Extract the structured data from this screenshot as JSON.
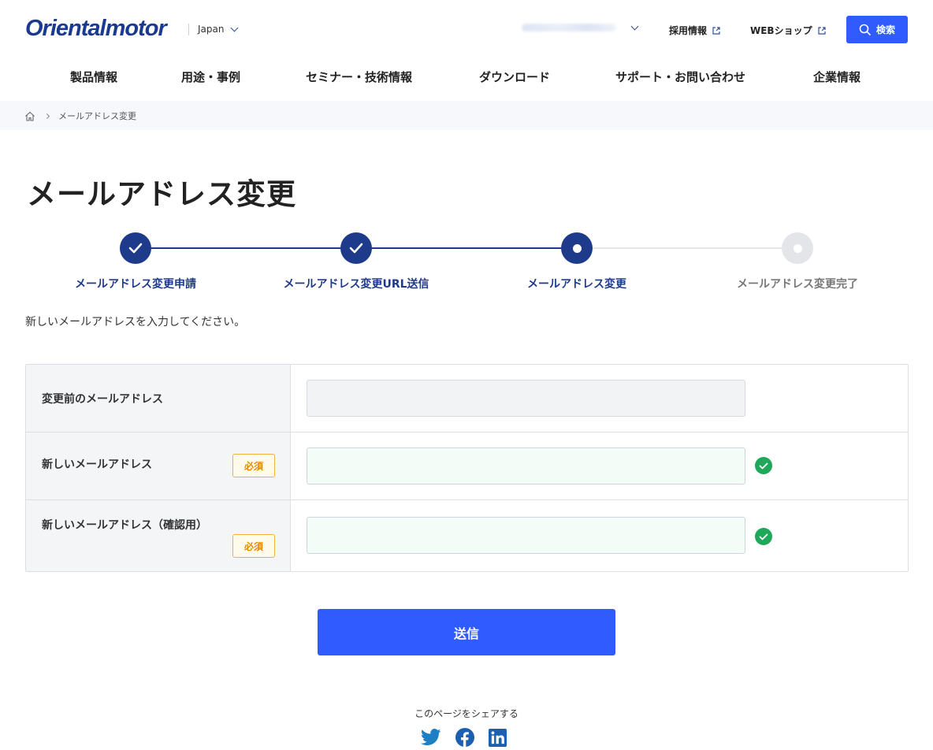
{
  "header": {
    "logo": "Orientalmotor",
    "region": "Japan",
    "links": [
      {
        "label": "採用情報"
      },
      {
        "label": "WEBショップ"
      }
    ],
    "search_label": "検索"
  },
  "nav": {
    "items": [
      {
        "label": "製品情報"
      },
      {
        "label": "用途・事例"
      },
      {
        "label": "セミナー・技術情報"
      },
      {
        "label": "ダウンロード"
      },
      {
        "label": "サポート・お問い合わせ"
      },
      {
        "label": "企業情報"
      }
    ]
  },
  "breadcrumb": {
    "current": "メールアドレス変更"
  },
  "page_title": "メールアドレス変更",
  "steps": [
    {
      "label": "メールアドレス変更申請",
      "state": "done"
    },
    {
      "label": "メールアドレス変更URL送信",
      "state": "done"
    },
    {
      "label": "メールアドレス変更",
      "state": "current"
    },
    {
      "label": "メールアドレス変更完了",
      "state": "todo"
    }
  ],
  "intro": "新しいメールアドレスを入力してください。",
  "form": {
    "required_badge": "必須",
    "rows": [
      {
        "label": "変更前のメールアドレス",
        "value": "",
        "required": false
      },
      {
        "label": "新しいメールアドレス",
        "value": "",
        "required": true
      },
      {
        "label": "新しいメールアドレス（確認用）",
        "value": "",
        "required": true
      }
    ]
  },
  "submit_label": "送信",
  "share": {
    "label": "このページをシェアする",
    "icons": [
      "twitter-icon",
      "facebook-icon",
      "linkedin-icon"
    ]
  },
  "colors": {
    "primary": "#2f5bff",
    "brand": "#1a3a8f",
    "step_done": "#1e3a8a",
    "step_todo": "#e3e5e8",
    "valid": "#1fa85a",
    "required": "#e58a00"
  }
}
